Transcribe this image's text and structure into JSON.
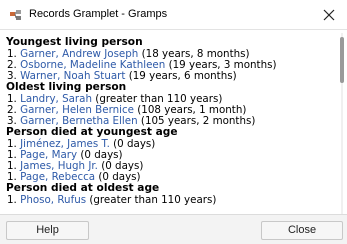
{
  "window": {
    "title": "Records Gramplet - Gramps",
    "icon": "gramps-app-icon",
    "close_icon": "close-icon"
  },
  "sections": [
    {
      "heading": "Youngest living person",
      "entries": [
        {
          "index": "1.",
          "name": "Garner, Andrew Joseph",
          "detail": "(18 years, 8 months)"
        },
        {
          "index": "2.",
          "name": "Osborne, Madeline Kathleen",
          "detail": "(19 years, 3 months)"
        },
        {
          "index": "3.",
          "name": "Warner, Noah Stuart",
          "detail": "(19 years, 6 months)"
        }
      ]
    },
    {
      "heading": "Oldest living person",
      "entries": [
        {
          "index": "1.",
          "name": "Landry, Sarah",
          "detail": "(greater than 110 years)"
        },
        {
          "index": "2.",
          "name": "Garner, Helen Bernice",
          "detail": "(108 years, 1 month)"
        },
        {
          "index": "3.",
          "name": "Garner, Bernetha Ellen",
          "detail": "(105 years, 2 months)"
        }
      ]
    },
    {
      "heading": "Person died at youngest age",
      "entries": [
        {
          "index": "1.",
          "name": "Jiménez, James T.",
          "detail": "(0 days)"
        },
        {
          "index": "1.",
          "name": "Page, Mary",
          "detail": "(0 days)"
        },
        {
          "index": "1.",
          "name": "James, Hugh Jr.",
          "detail": "(0 days)"
        },
        {
          "index": "1.",
          "name": "Page, Rebecca",
          "detail": "(0 days)"
        }
      ]
    },
    {
      "heading": "Person died at oldest age",
      "entries": [
        {
          "index": "1.",
          "name": "Phoso, Rufus",
          "detail": "(greater than 110 years)"
        }
      ]
    }
  ],
  "footer": {
    "help_label": "Help",
    "close_label": "Close"
  },
  "colors": {
    "link": "#2e5aa8",
    "footer_bg": "#f3f3f3",
    "scrollbar_thumb": "#9a9a9a"
  }
}
